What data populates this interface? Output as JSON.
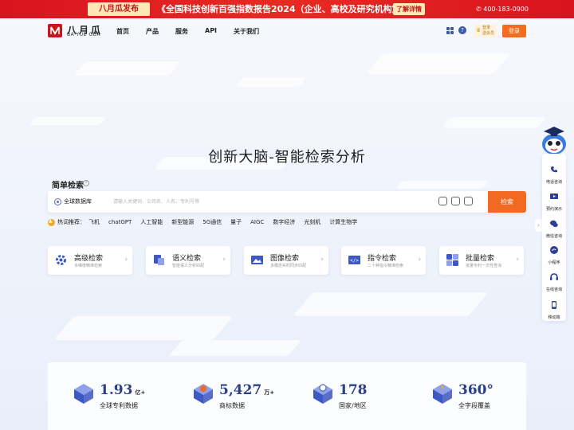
{
  "banner": {
    "tag": "八月瓜发布",
    "headline": "《全国科技创新百强指数报告2024（企业、高校及研究机构篇）》",
    "detail_button": "了解详情",
    "phone": "400-183-0900"
  },
  "logo": {
    "name": "八月瓜",
    "subtitle": "BA YUE GUA"
  },
  "nav": {
    "items": [
      "首页",
      "产品",
      "服务",
      "API",
      "关于我们"
    ],
    "vip_line1": "登录",
    "vip_line2": "送会员",
    "login": "登录"
  },
  "hero": {
    "title": "创新大脑-智能检索分析",
    "simple_search_label": "简单检索"
  },
  "search": {
    "database": "全球数据库",
    "placeholder": "请输入关键词、公司名、人名、专利号等",
    "button": "检索"
  },
  "hot": {
    "label": "热词推荐：",
    "keywords": [
      "飞机",
      "chatGPT",
      "人工智能",
      "新型能源",
      "5G通信",
      "量子",
      "AIGC",
      "数字经济",
      "光刻机",
      "计算生物学"
    ]
  },
  "cards": [
    {
      "title": "高级检索",
      "subtitle": "多维度精准检索",
      "icon": "advanced-search-icon",
      "color": "#3d57c4"
    },
    {
      "title": "语义检索",
      "subtitle": "智能语义分析匹配",
      "icon": "semantic-search-icon",
      "color": "#3d57c4"
    },
    {
      "title": "图像检索",
      "subtitle": "多模态实时同步匹配",
      "icon": "image-search-icon",
      "color": "#3d57c4"
    },
    {
      "title": "指令检索",
      "subtitle": "二十种指令精准检索",
      "icon": "command-search-icon",
      "color": "#3d57c4"
    },
    {
      "title": "批量检索",
      "subtitle": "批量专利一次性查询",
      "icon": "batch-search-icon",
      "color": "#3d57c4"
    }
  ],
  "stats": [
    {
      "value": "1.93",
      "unit": "亿+",
      "label": "全球专利数据",
      "icon": "patent-data-icon"
    },
    {
      "value": "5,427",
      "unit": "万+",
      "label": "商标数据",
      "icon": "trademark-data-icon"
    },
    {
      "value": "178",
      "unit": "",
      "label": "国家/地区",
      "icon": "region-icon"
    },
    {
      "value": "360°",
      "unit": "",
      "label": "全字段覆盖",
      "icon": "coverage-icon"
    }
  ],
  "sidebar": {
    "items": [
      {
        "label": "电话咨询",
        "icon": "phone-icon"
      },
      {
        "label": "预约演示",
        "icon": "demo-icon"
      },
      {
        "label": "微信咨询",
        "icon": "wechat-icon"
      },
      {
        "label": "小程序",
        "icon": "mini-program-icon"
      },
      {
        "label": "在线咨询",
        "icon": "headset-icon"
      },
      {
        "label": "移动端",
        "icon": "mobile-icon"
      }
    ]
  },
  "colors": {
    "brand_red": "#d8141e",
    "accent_orange": "#f26a22",
    "primary_blue": "#2d3f96"
  }
}
